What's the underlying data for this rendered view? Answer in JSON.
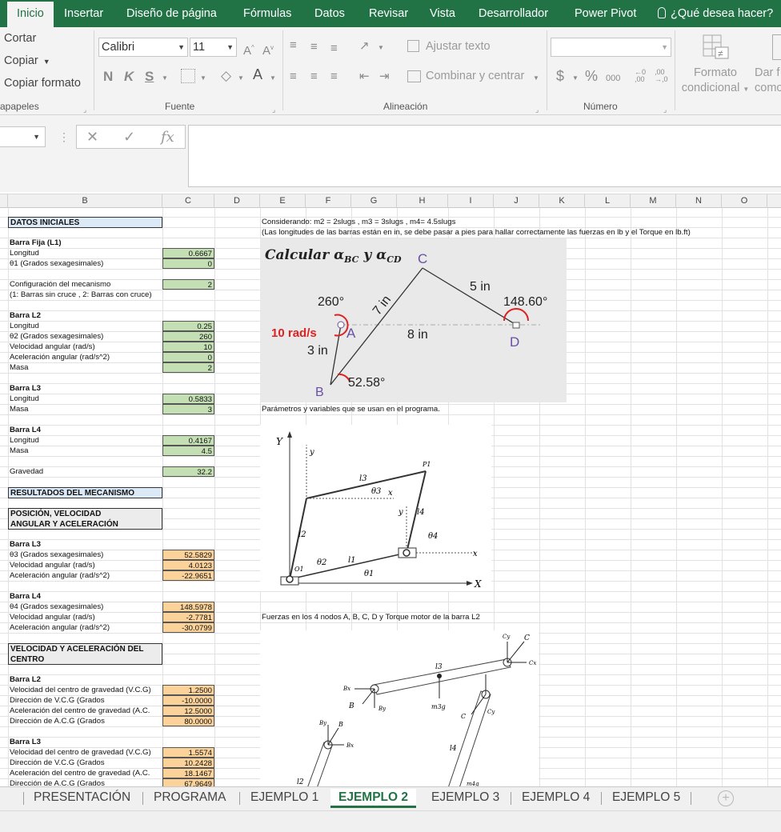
{
  "ribbon_tabs": [
    "Inicio",
    "Insertar",
    "Diseño de página",
    "Fórmulas",
    "Datos",
    "Revisar",
    "Vista",
    "Desarrollador",
    "Power Pivot"
  ],
  "tell_me": "¿Qué desea hacer?",
  "clipboard": {
    "cut": "Cortar",
    "copy": "Copiar",
    "format_painter": "Copiar formato",
    "label": "apapeles"
  },
  "font": {
    "name": "Calibri",
    "size": "11",
    "label": "Fuente",
    "bold": "N",
    "italic": "K",
    "underline": "S"
  },
  "alignment": {
    "wrap": "Ajustar texto",
    "merge": "Combinar y centrar",
    "label": "Alineación"
  },
  "number": {
    "currency": "$",
    "percent": "%",
    "thousands": "000",
    "label": "Número",
    "format_value": ""
  },
  "styles": {
    "conditional": "Formato condicional",
    "conditional_line1": "Formato",
    "conditional_line2": "condicional",
    "table_line1": "Dar f",
    "table_line2": "como"
  },
  "formula_bar": {
    "fx": "fx",
    "value": ""
  },
  "columns": [
    "B",
    "C",
    "D",
    "E",
    "F",
    "G",
    "H",
    "I",
    "J",
    "K",
    "L",
    "M",
    "N",
    "O"
  ],
  "sheet": {
    "datos_iniciales": "DATOS INICIALES",
    "barra_fija": "Barra Fija (L1)",
    "longitud": "Longitud",
    "theta1": "θ1 (Grados sexagesimales)",
    "config": "Configuración del mecanismo",
    "config_note": "(1: Barras sin cruce , 2: Barras con cruce)",
    "barra_l2": "Barra L2",
    "theta2": "θ2 (Grados sexagesimales)",
    "vel_ang": "Velocidad angular (rad/s)",
    "acel_ang": "Aceleración angular (rad/s^2)",
    "masa": "Masa",
    "barra_l3": "Barra L3",
    "barra_l4": "Barra L4",
    "gravedad": "Gravedad",
    "resultados": "RESULTADOS DEL MECANISMO",
    "posvel_1": "POSICIÓN, VELOCIDAD",
    "posvel_2": "ANGULAR Y ACELERACIÓN",
    "theta3": "θ3 (Grados sexagesimales)",
    "theta4": "θ4 (Grados sexagesimales)",
    "velacel_1": "VELOCIDAD Y ACELERACIÓN DEL",
    "velacel_2": "CENTRO",
    "vcg": "Velocidad del centro de gravedad (V.C.G)",
    "dir_vcg": "Dirección de V.C.G (Grados",
    "acg": "Aceleración del centro de gravedad (A.C.",
    "dir_acg": "Dirección de A.C.G (Grados",
    "values": {
      "l1_len": "0.6667",
      "l1_theta": "0",
      "config": "2",
      "l2_len": "0.25",
      "l2_theta": "260",
      "l2_vel": "10",
      "l2_acel": "0",
      "l2_masa": "2",
      "l3_len": "0.5833",
      "l3_masa": "3",
      "l4_len": "0.4167",
      "l4_masa": "4.5",
      "grav": "32.2",
      "r_theta3": "52.5829",
      "r_vel3": "4.0123",
      "r_acel3": "-22.9651",
      "r_theta4": "148.5978",
      "r_vel4": "-2.7781",
      "r_acel4": "-30.0799",
      "l2_vcg": "1.2500",
      "l2_dvcg": "-10.0000",
      "l2_acg": "12.5000",
      "l2_dacg": "80.0000",
      "l3_vcg": "1.5574",
      "l3_dvcg": "10.2428",
      "l3_acg": "18.1467",
      "l3_dacg": "67.9649"
    },
    "note1": "Considerando: m2 = 2slugs , m3 = 3slugs , m4= 4.5slugs",
    "note2": "(Las longitudes de las barras están en in, se debe pasar a pies para hallar correctamente las fuerzas en lb y el Torque en lb.ft)",
    "note3": "Parámetros y variables que se usan en el programa.",
    "note4": "Fuerzas en los 4 nodos A, B, C, D y Torque motor de la barra L2"
  },
  "figure1": {
    "title_prefix": "Calcular ",
    "title_a": "α",
    "title_bc": "BC",
    "title_mid": " y ",
    "title_cd": "CD",
    "pt_a": "A",
    "pt_b": "B",
    "pt_c": "C",
    "pt_d": "D",
    "omega": "10 rad/s",
    "len_ab": "3 in",
    "len_bc": "7 in",
    "len_cd": "5 in",
    "len_ad": "8 in",
    "ang_a": "260°",
    "ang_d": "148.60°",
    "ang_b": "52.58°"
  },
  "figure2": {
    "y_axis": "Y",
    "x_axis": "X",
    "y_local": "y",
    "x_local": "x",
    "l1": "l1",
    "l2": "l2",
    "l3": "l3",
    "l4": "l4",
    "t1": "θ1",
    "t2": "θ2",
    "t3": "θ3",
    "t4": "θ4",
    "o1": "O1",
    "p1": "P1"
  },
  "figure3": {
    "c": "C",
    "cy": "Cy",
    "cx": "Cx",
    "b": "B",
    "by": "By",
    "bx": "Bx",
    "l3": "l3",
    "l4": "l4",
    "l2": "l2",
    "m3g": "m3g",
    "m4g": "m4g"
  },
  "sheet_tabs": [
    "PRESENTACIÓN",
    "PROGRAMA",
    "EJEMPLO 1",
    "EJEMPLO 2",
    "EJEMPLO 3",
    "EJEMPLO 4",
    "EJEMPLO 5"
  ],
  "active_sheet": "EJEMPLO 2",
  "colors": {
    "excel_green": "#217346",
    "input_fill": "#c4dfb3",
    "result_fill": "#fbd39a",
    "header_fill": "#dce9f6"
  }
}
